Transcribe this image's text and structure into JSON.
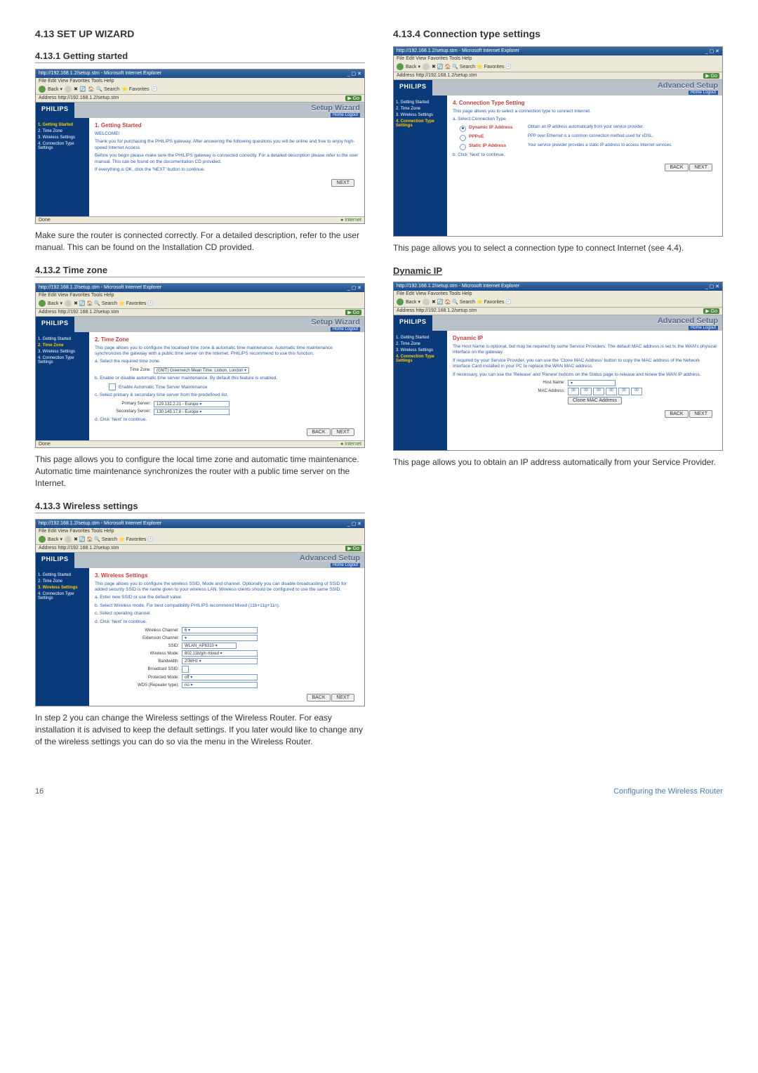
{
  "page": {
    "number": "16",
    "footer_right": "Configuring the Wireless Router"
  },
  "left": {
    "h_main": "4.13 SET UP WIZARD",
    "s1": {
      "heading": "4.13.1  Getting started",
      "ie_title": "http://192.168.1.2/setup.stm - Microsoft Internet Explorer",
      "ie_menu": "File   Edit   View   Favorites   Tools   Help",
      "ie_addr": "Address  http://192.168.1.2/setup.stm",
      "banner_title": "Setup Wizard",
      "banner_sub": "Home  Logout",
      "sidebar": [
        "1. Getting Started",
        "2. Time Zone",
        "3. Wireless Settings",
        "4. Connection Type Settings"
      ],
      "panel_title": "1. Getting Started",
      "welcome": "WELCOME!",
      "p1": "Thank you for purchasing the PHILIPS gateway. After answering the following questions you will be online and free to enjoy high-speed Internet Access.",
      "p2": "Before you begin please make sure the PHILIPS gateway is connected correctly. For a detailed description please refer to the user manual. This can be found on the documentation CD provided.",
      "p3": "If everything is OK, click the 'NEXT' button to continue.",
      "next": "NEXT",
      "done": "Done",
      "internet": "Internet",
      "caption": "Make sure the router is connected correctly. For a detailed description, refer to the user manual. This can be found on the Installation CD provided."
    },
    "s2": {
      "heading": "4.13.2  Time zone",
      "panel_title": "2. Time Zone",
      "desc": "This page allows you to configure the localised time zone & automatic time maintenance. Automatic time maintenance synchronizes the gateway with a public time server on the Internet. PHILIPS recommend to use this function.",
      "step_a": "a. Select the required time zone.",
      "tz_label": "Time Zone:",
      "tz_value": "(GMT) Greenwich Mean Time: Lisbon, London",
      "step_b": "b. Enable or disable automatic time server maintenance. By default this feature is enabled.",
      "enable_auto": "Enable Automatic Time Server Maintenance",
      "step_c": "c. Select primary & secondary time server from the predefined list.",
      "primary_label": "Primary Server:",
      "primary_value": "129.132.2.21 - Europe",
      "secondary_label": "Secondary Server:",
      "secondary_value": "130.149.17.8 - Europe",
      "step_d": "d. Click 'Next' to continue.",
      "back": "BACK",
      "next": "NEXT",
      "caption": "This page allows you to configure the local time zone and automatic time maintenance. Automatic time maintenance synchronizes the router with a public time server on the Internet."
    },
    "s3": {
      "heading": "4.13.3  Wireless settings",
      "panel_title": "3. Wireless Settings",
      "desc": "This page allows you to configure the wireless SSID, Mode and channel. Optionally you can disable broadcasting of SSID for added security SSID is the name given to your wireless LAN. Wireless clients should be configured to use the same SSID.",
      "a": "a. Enter new SSID or use the default value.",
      "b": "b. Select Wireless mode. For best compatibility PHILIPS recommend Mixed (11b+11g+11n).",
      "c": "c. Select operating channel.",
      "d": "d. Click 'Next' to continue.",
      "fields": {
        "wchan_l": "Wireless Channel:",
        "wchan_v": "6",
        "ext_l": "Extension Channel:",
        "ext_v": "",
        "ssid_l": "SSID:",
        "ssid_v": "WLAN_AP6310",
        "mode_l": "Wireless Mode:",
        "mode_v": "802.11b/g/n mixed",
        "bw_l": "Bandwidth:",
        "bw_v": "20MHz",
        "bcast_l": "Broadcast SSID:",
        "prot_l": "Protected Mode:",
        "prot_v": "off",
        "wds_l": "WDS (Repeater type):",
        "wds_v": "no"
      },
      "back": "BACK",
      "next": "NEXT",
      "caption": "In step 2 you can change the Wireless settings of the Wireless Router. For easy installation it is advised to keep the default settings. If you later would like to change any of the wireless settings you can do so via the menu in the Wireless Router."
    }
  },
  "right": {
    "s4": {
      "heading": "4.13.4  Connection type settings",
      "banner_title": "Advanced Setup",
      "panel_title": "4. Connection Type Setting",
      "desc": "This page allows you to select a connection type to connect Internet.",
      "a": "a. Select Connection Type.",
      "opts": [
        {
          "label": "Dynamic IP Address",
          "desc": "Obtain an IP address automatically from your service provider."
        },
        {
          "label": "PPPoE",
          "desc": "PPP over Ethernet is a common connection method used for xDSL."
        },
        {
          "label": "Static IP Address",
          "desc": "Your service provider provides a static IP address to access Internet services."
        }
      ],
      "b": "b. Click 'Next' to continue.",
      "back": "BACK",
      "next": "NEXT",
      "caption": "This page allows you to select a connection type to connect Internet (see 4.4)."
    },
    "s5": {
      "heading": "Dynamic IP",
      "panel_title": "Dynamic IP",
      "p1": "The Host Name is optional, but may be required by some Service Providers. The default MAC address is set to the WAN's physical interface on the gateway.",
      "p2": "If required by your Service Provider, you can use the 'Clone MAC Address' button to copy the MAC address of the Network Interface Card installed in your PC to replace the WAN MAC address.",
      "p3": "If necessary, you can use the 'Release' and 'Renew' buttons on the Status page to release and renew the WAN IP address.",
      "host_l": "Host Name:",
      "mac_l": "MAC Address:",
      "mac": [
        "00",
        "00",
        "00",
        "00",
        "00",
        "00"
      ],
      "clone": "Clone MAC Address",
      "back": "BACK",
      "next": "NEXT",
      "caption": "This page allows you to obtain an IP address automatically from your Service Provider."
    }
  }
}
